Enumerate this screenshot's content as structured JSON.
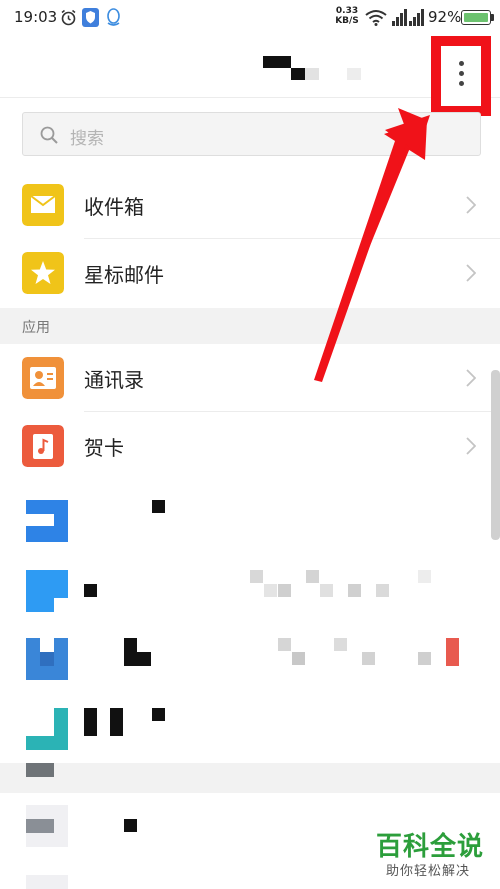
{
  "status_bar": {
    "time": "19:03",
    "net_speed_value": "0.33",
    "net_speed_unit": "KB/S",
    "battery_text": "92%"
  },
  "search": {
    "placeholder": "搜索"
  },
  "mail_items": [
    {
      "label": "收件箱",
      "icon": "inbox-icon",
      "color": "#f0c419"
    },
    {
      "label": "星标邮件",
      "icon": "star-icon",
      "color": "#f0c419"
    }
  ],
  "apps_section": {
    "header": "应用",
    "items": [
      {
        "label": "通讯录",
        "icon": "contacts-icon",
        "color": "#f0913a"
      },
      {
        "label": "贺卡",
        "icon": "greeting-card-icon",
        "color": "#ec5b3d"
      }
    ]
  },
  "colors": {
    "highlight_box": "#f01219",
    "arrow": "#f01219",
    "accent_yellow": "#f0c419",
    "watermark_green": "#2c9e3b"
  },
  "watermark": {
    "title": "百科全说",
    "subtitle": "助你轻松解决"
  }
}
